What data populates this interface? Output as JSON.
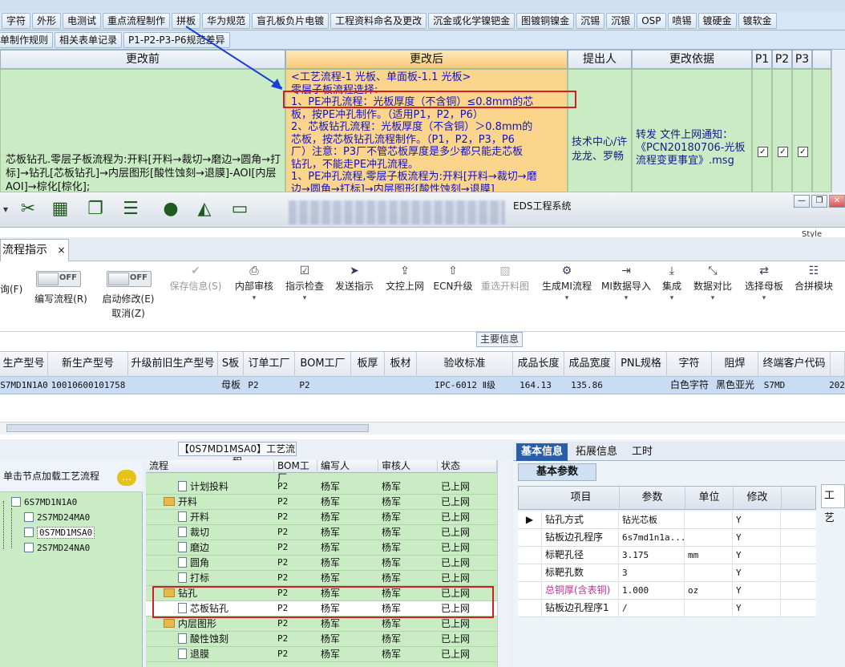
{
  "top_tabs_row1": [
    "字符",
    "外形",
    "电测试",
    "重点流程制作",
    "拼板",
    "华为规范",
    "盲孔板负片电镀",
    "工程资料命名及更改",
    "沉金或化学镍钯金",
    "图镀铜镍金",
    "沉锡",
    "沉银",
    "OSP",
    "喷锡",
    "镀硬金",
    "镀软金"
  ],
  "top_tabs_row2": [
    "单制作规则",
    "相关表单记录",
    "P1-P2-P3-P6规范差异"
  ],
  "change_table": {
    "headers": {
      "before": "更改前",
      "after": "更改后",
      "person": "提出人",
      "basis": "更改依据",
      "p1": "P1",
      "p2": "P2",
      "p3": "P3"
    },
    "before_text": "芯板钻孔.零层子板流程为:开料[开料→裁切→磨边→圆角→打标]→钻孔[芯板钻孔]→内层图形[酸性蚀刻→退膜]-AOI[内层AOI]→棕化[棕化];",
    "after_lines": [
      "<工艺流程-1 光板、单面板-1.1 光板>",
      "零层子板流程选择:",
      "1、PE冲孔流程：光板厚度（不含铜）≤0.8mm的芯",
      "板，按PE冲孔制作。（适用P1，P2，P6）",
      "2、芯板钻孔流程：光板厚度（不含铜）＞0.8mm的",
      "芯板，按芯板钻孔流程制作。（P1，P2，P3，P6",
      "厂）注意：P3厂不管芯板厚度是多少都只能走芯板",
      "钻孔，不能走PE冲孔流程。",
      "1、PE冲孔流程,零层子板流程为:开料[开料→裁切→磨",
      "边→圆角→打标]→内层图形[酸性蚀刻→退膜]"
    ],
    "person": "技术中心/许龙龙、罗畅",
    "basis": "转发  文件上网通知：《PCN20180706-光板流程变更事宜》.msg",
    "checks": [
      "✓",
      "✓",
      "✓"
    ]
  },
  "eds": {
    "title": "EDS工程系统",
    "style_label": "Style",
    "toolbar_icons": [
      "scissors-icon",
      "film-icon",
      "clipboard-icon",
      "list-icon",
      "user-icon",
      "chart-icon",
      "monitor-icon"
    ]
  },
  "doc_tab": {
    "label": "流程指示",
    "close": "×"
  },
  "ribbon": {
    "query": "询(F)",
    "edit_flow": "编写流程(R)",
    "enable_edit": "启动修改(E)",
    "cancel": "取消(Z)",
    "toggle_off": "OFF",
    "save_info": "保存信息(S)",
    "internal_review": "内部审核",
    "instruction_check": "指示检查",
    "send_instruction": "发送指示",
    "doc_upload": "文控上网",
    "ecn_upgrade": "ECN升级",
    "reselect_cutting": "重选开料图",
    "generate_mi": "生成MI流程",
    "mi_import": "MI数据导入",
    "integrate": "集成",
    "data_compare": "数据对比",
    "select_mother": "选择母板",
    "merge_module": "合拼模块"
  },
  "main_info_label": "主要信息",
  "grid_headers": [
    "生产型号",
    "新生产型号",
    "升级前旧生产型号",
    "S板",
    "订单工厂",
    "BOM工厂",
    "板厚",
    "板材",
    "验收标准",
    "成品长度",
    "成品宽度",
    "PNL规格",
    "字符",
    "阻焊",
    "终端客户代码"
  ],
  "grid_row": [
    "S7MD1N1A0",
    "10010600101758",
    "",
    "母板",
    "P2",
    "P2",
    "",
    "",
    "IPC-6012 Ⅱ级",
    "164.13",
    "135.86",
    "",
    "白色字符",
    "黑色亚光",
    "S7MD",
    "202"
  ],
  "flow_panel": {
    "title": "【0S7MD1MSA0】工艺流程",
    "hint": "单击节点加载工艺流程",
    "nodes": [
      {
        "label": "6S7MD1N1A0"
      },
      {
        "label": "2S7MD24MA0"
      },
      {
        "label": "0S7MD1MSA0"
      },
      {
        "label": "2S7MD24NA0"
      }
    ],
    "headers": [
      "流程",
      "BOM工厂",
      "编写人",
      "审核人",
      "状态"
    ],
    "rows": [
      {
        "name": "计划投料",
        "bom": "P2",
        "writer": "杨军",
        "reviewer": "杨军",
        "status": "已上网",
        "type": "file",
        "level": 2
      },
      {
        "name": "开料",
        "bom": "P2",
        "writer": "杨军",
        "reviewer": "杨军",
        "status": "已上网",
        "type": "folder",
        "level": 1
      },
      {
        "name": "开料",
        "bom": "P2",
        "writer": "杨军",
        "reviewer": "杨军",
        "status": "已上网",
        "type": "file",
        "level": 2
      },
      {
        "name": "裁切",
        "bom": "P2",
        "writer": "杨军",
        "reviewer": "杨军",
        "status": "已上网",
        "type": "file",
        "level": 2
      },
      {
        "name": "磨边",
        "bom": "P2",
        "writer": "杨军",
        "reviewer": "杨军",
        "status": "已上网",
        "type": "file",
        "level": 2
      },
      {
        "name": "圆角",
        "bom": "P2",
        "writer": "杨军",
        "reviewer": "杨军",
        "status": "已上网",
        "type": "file",
        "level": 2
      },
      {
        "name": "打标",
        "bom": "P2",
        "writer": "杨军",
        "reviewer": "杨军",
        "status": "已上网",
        "type": "file",
        "level": 2
      },
      {
        "name": "钻孔",
        "bom": "P2",
        "writer": "杨军",
        "reviewer": "杨军",
        "status": "已上网",
        "type": "folder",
        "level": 1
      },
      {
        "name": "芯板钻孔",
        "bom": "P2",
        "writer": "杨军",
        "reviewer": "杨军",
        "status": "已上网",
        "type": "file",
        "level": 2
      },
      {
        "name": "内层图形",
        "bom": "P2",
        "writer": "杨军",
        "reviewer": "杨军",
        "status": "已上网",
        "type": "folder",
        "level": 1
      },
      {
        "name": "酸性蚀刻",
        "bom": "P2",
        "writer": "杨军",
        "reviewer": "杨军",
        "status": "已上网",
        "type": "file",
        "level": 2
      },
      {
        "name": "退膜",
        "bom": "P2",
        "writer": "杨军",
        "reviewer": "杨军",
        "status": "已上网",
        "type": "file",
        "level": 2
      }
    ]
  },
  "right_panel": {
    "tabs": [
      "基本信息",
      "拓展信息",
      "工时"
    ],
    "section": "基本参数",
    "headers": [
      "项目",
      "参数",
      "单位",
      "修改"
    ],
    "rows": [
      {
        "item": "钻孔方式",
        "param": "钻光芯板",
        "unit": "",
        "mod": "Y"
      },
      {
        "item": "钻板边孔程序",
        "param": "6s7md1n1a...",
        "unit": "",
        "mod": "Y"
      },
      {
        "item": "标靶孔径",
        "param": "3.175",
        "unit": "mm",
        "mod": "Y"
      },
      {
        "item": "标靶孔数",
        "param": "3",
        "unit": "",
        "mod": "Y"
      },
      {
        "item": "总铜厚(含表铜)",
        "param": "1.000",
        "unit": "oz",
        "mod": "Y"
      },
      {
        "item": "钻板边孔程序1",
        "param": "/",
        "unit": "",
        "mod": "Y"
      }
    ],
    "side_tab": "工艺",
    "accent_color": "#2a5ea8",
    "highlight_color": "#c03090"
  }
}
